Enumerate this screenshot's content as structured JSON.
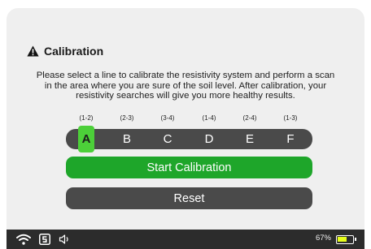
{
  "header": {
    "icon": "warning-icon",
    "title": "Calibration"
  },
  "description": {
    "line1": "Please select a line to calibrate the resistivity system and perform a scan",
    "line2": "in the area where you are sure of the soil level. After calibration, your",
    "line3": "resistivity searches will give you more healthy results."
  },
  "lines": [
    {
      "id": "A",
      "range": "(1-2)",
      "selected": true
    },
    {
      "id": "B",
      "range": "(2-3)",
      "selected": false
    },
    {
      "id": "C",
      "range": "(3-4)",
      "selected": false
    },
    {
      "id": "D",
      "range": "(1-4)",
      "selected": false
    },
    {
      "id": "E",
      "range": "(2-4)",
      "selected": false
    },
    {
      "id": "F",
      "range": "(1-3)",
      "selected": false
    }
  ],
  "buttons": {
    "start": "Start Calibration",
    "reset": "Reset"
  },
  "status_bar": {
    "icons": [
      "wifi-icon",
      "s-app-icon",
      "volume-icon",
      "battery-icon"
    ],
    "battery_percent": "67%",
    "battery_level": 0.67
  },
  "colors": {
    "accent_green": "#1ea62a",
    "selected_green": "#4ccf39",
    "dark_control": "#4a4a4a",
    "battery_fill": "#e8ff1a"
  }
}
